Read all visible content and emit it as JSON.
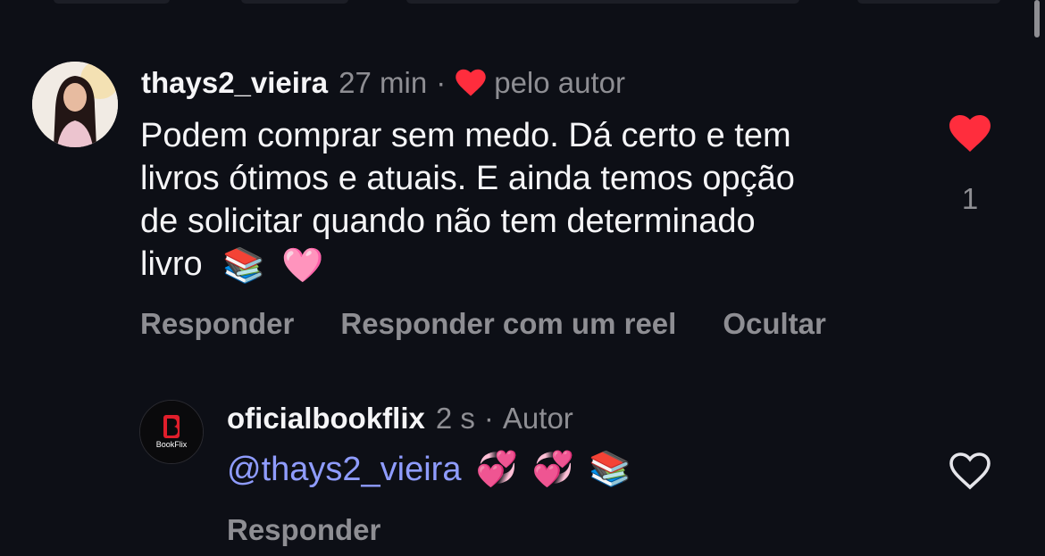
{
  "comment": {
    "username": "thays2_vieira",
    "time": "27 min",
    "separator": "·",
    "liked_by_author": "pelo autor",
    "text_lines": [
      "Podem comprar sem medo. Dá certo e tem",
      "livros ótimos e atuais. E ainda temos opção",
      "de solicitar quando não tem determinado",
      "livro"
    ],
    "emojis": [
      "📚",
      "🩷"
    ],
    "like_count": "1",
    "actions": [
      "Responder",
      "Responder com um reel",
      "Ocultar"
    ]
  },
  "reply": {
    "username": "oficialbookflix",
    "time": "2 s",
    "separator": "·",
    "role": "Autor",
    "mention": "@thays2_vieira",
    "emojis": [
      "💞",
      "💞",
      "📚"
    ],
    "action": "Responder",
    "avatar_logo_text": "BookFlix"
  },
  "colors": {
    "background": "#0d0f16",
    "text": "#f5f5f7",
    "secondary": "#8e8e93",
    "mention": "#8f9cff",
    "like_red": "#ff2d3d"
  },
  "icons": {
    "liked": "heart-filled-icon",
    "unliked": "heart-outline-icon"
  }
}
